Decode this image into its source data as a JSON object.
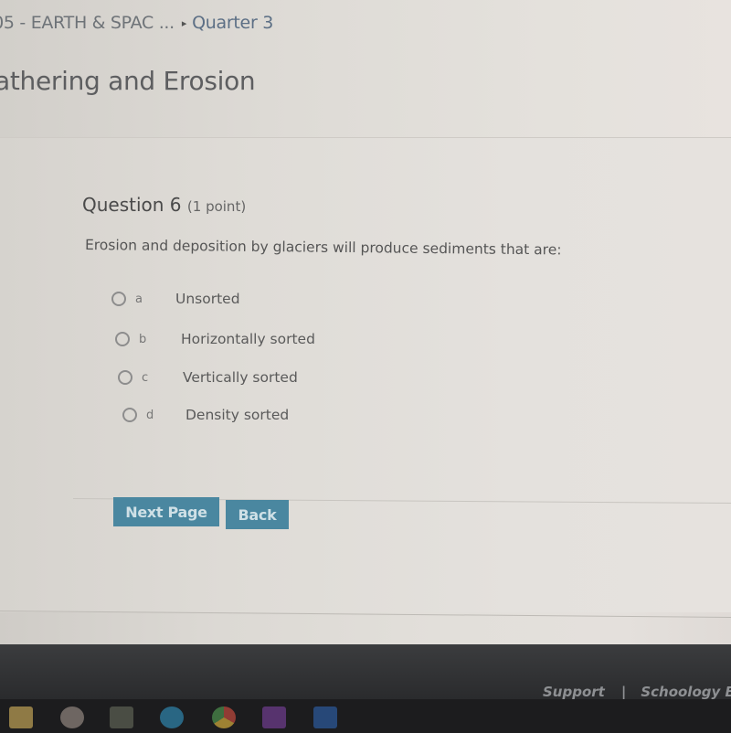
{
  "breadcrumb": {
    "course": "/05 - EARTH & SPAC ...",
    "separator": "▸",
    "section": "Quarter 3"
  },
  "page_title": "athering and Erosion",
  "question": {
    "heading": "Question 6",
    "points": "(1 point)",
    "text": "Erosion and deposition by glaciers will produce sediments that are:",
    "options": [
      {
        "letter": "a",
        "text": "Unsorted",
        "selected": false
      },
      {
        "letter": "b",
        "text": "Horizontally sorted",
        "selected": false
      },
      {
        "letter": "c",
        "text": "Vertically sorted",
        "selected": false
      },
      {
        "letter": "d",
        "text": "Density sorted",
        "selected": false
      }
    ]
  },
  "buttons": {
    "next": "Next Page",
    "back": "Back"
  },
  "footer": {
    "support": "Support",
    "pipe": "|",
    "blog": "Schoology B"
  },
  "taskbar": {
    "icons": [
      "file-explorer-icon",
      "app-icon",
      "app-icon-2",
      "edge-icon",
      "chrome-icon",
      "onenote-icon",
      "word-icon"
    ]
  },
  "colors": {
    "button_bg": "#4a87a0",
    "button_text": "#cfe0e6",
    "breadcrumb_link": "#5c6f85"
  }
}
